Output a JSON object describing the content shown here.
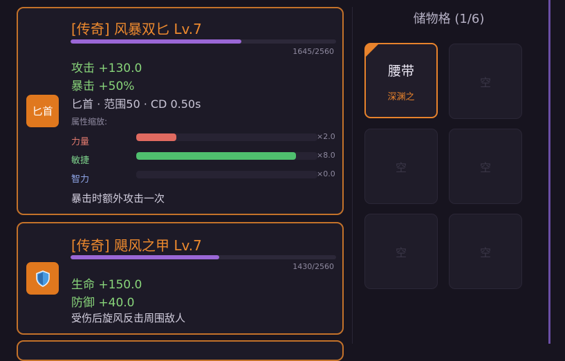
{
  "equipment": [
    {
      "icon_label": "匕首",
      "title": "[传奇] 风暴双匕 Lv.7",
      "xp_text": "1645/2560",
      "xp_fraction": 0.6426,
      "stats": [
        "攻击 +130.0",
        "暴击 +50%"
      ],
      "meta": "匕首 · 范围50 · CD 0.50s",
      "scaling_header": "属性缩放:",
      "attributes": [
        {
          "label": "力量",
          "multiplier": "×2.0",
          "fill": 0.22,
          "color": "#e06a60"
        },
        {
          "label": "敏捷",
          "multiplier": "×8.0",
          "fill": 0.88,
          "color": "#4fbf6e"
        },
        {
          "label": "智力",
          "multiplier": "×0.0",
          "fill": 0.0,
          "color": "#7a8de0"
        }
      ],
      "effect": "暴击时额外攻击一次"
    },
    {
      "icon": "shield-icon",
      "title": "[传奇] 飓风之甲 Lv.7",
      "xp_text": "1430/2560",
      "xp_fraction": 0.5586,
      "stats": [
        "生命 +150.0",
        "防御 +40.0"
      ],
      "effect": "受伤后旋风反击周围敌人"
    }
  ],
  "storage": {
    "title": "储物格 (1/6)",
    "slots": [
      {
        "name": "腰带",
        "sub": "深渊之",
        "filled": true
      },
      {
        "empty_label": "空"
      },
      {
        "empty_label": "空"
      },
      {
        "empty_label": "空"
      },
      {
        "empty_label": "空"
      },
      {
        "empty_label": "空"
      }
    ]
  },
  "colors": {
    "accent_orange": "#e0781e",
    "title_orange": "#ee8a2e",
    "stat_green": "#88d47a",
    "xp_purple": "#9a67d6",
    "border_orange": "#c4722a"
  }
}
